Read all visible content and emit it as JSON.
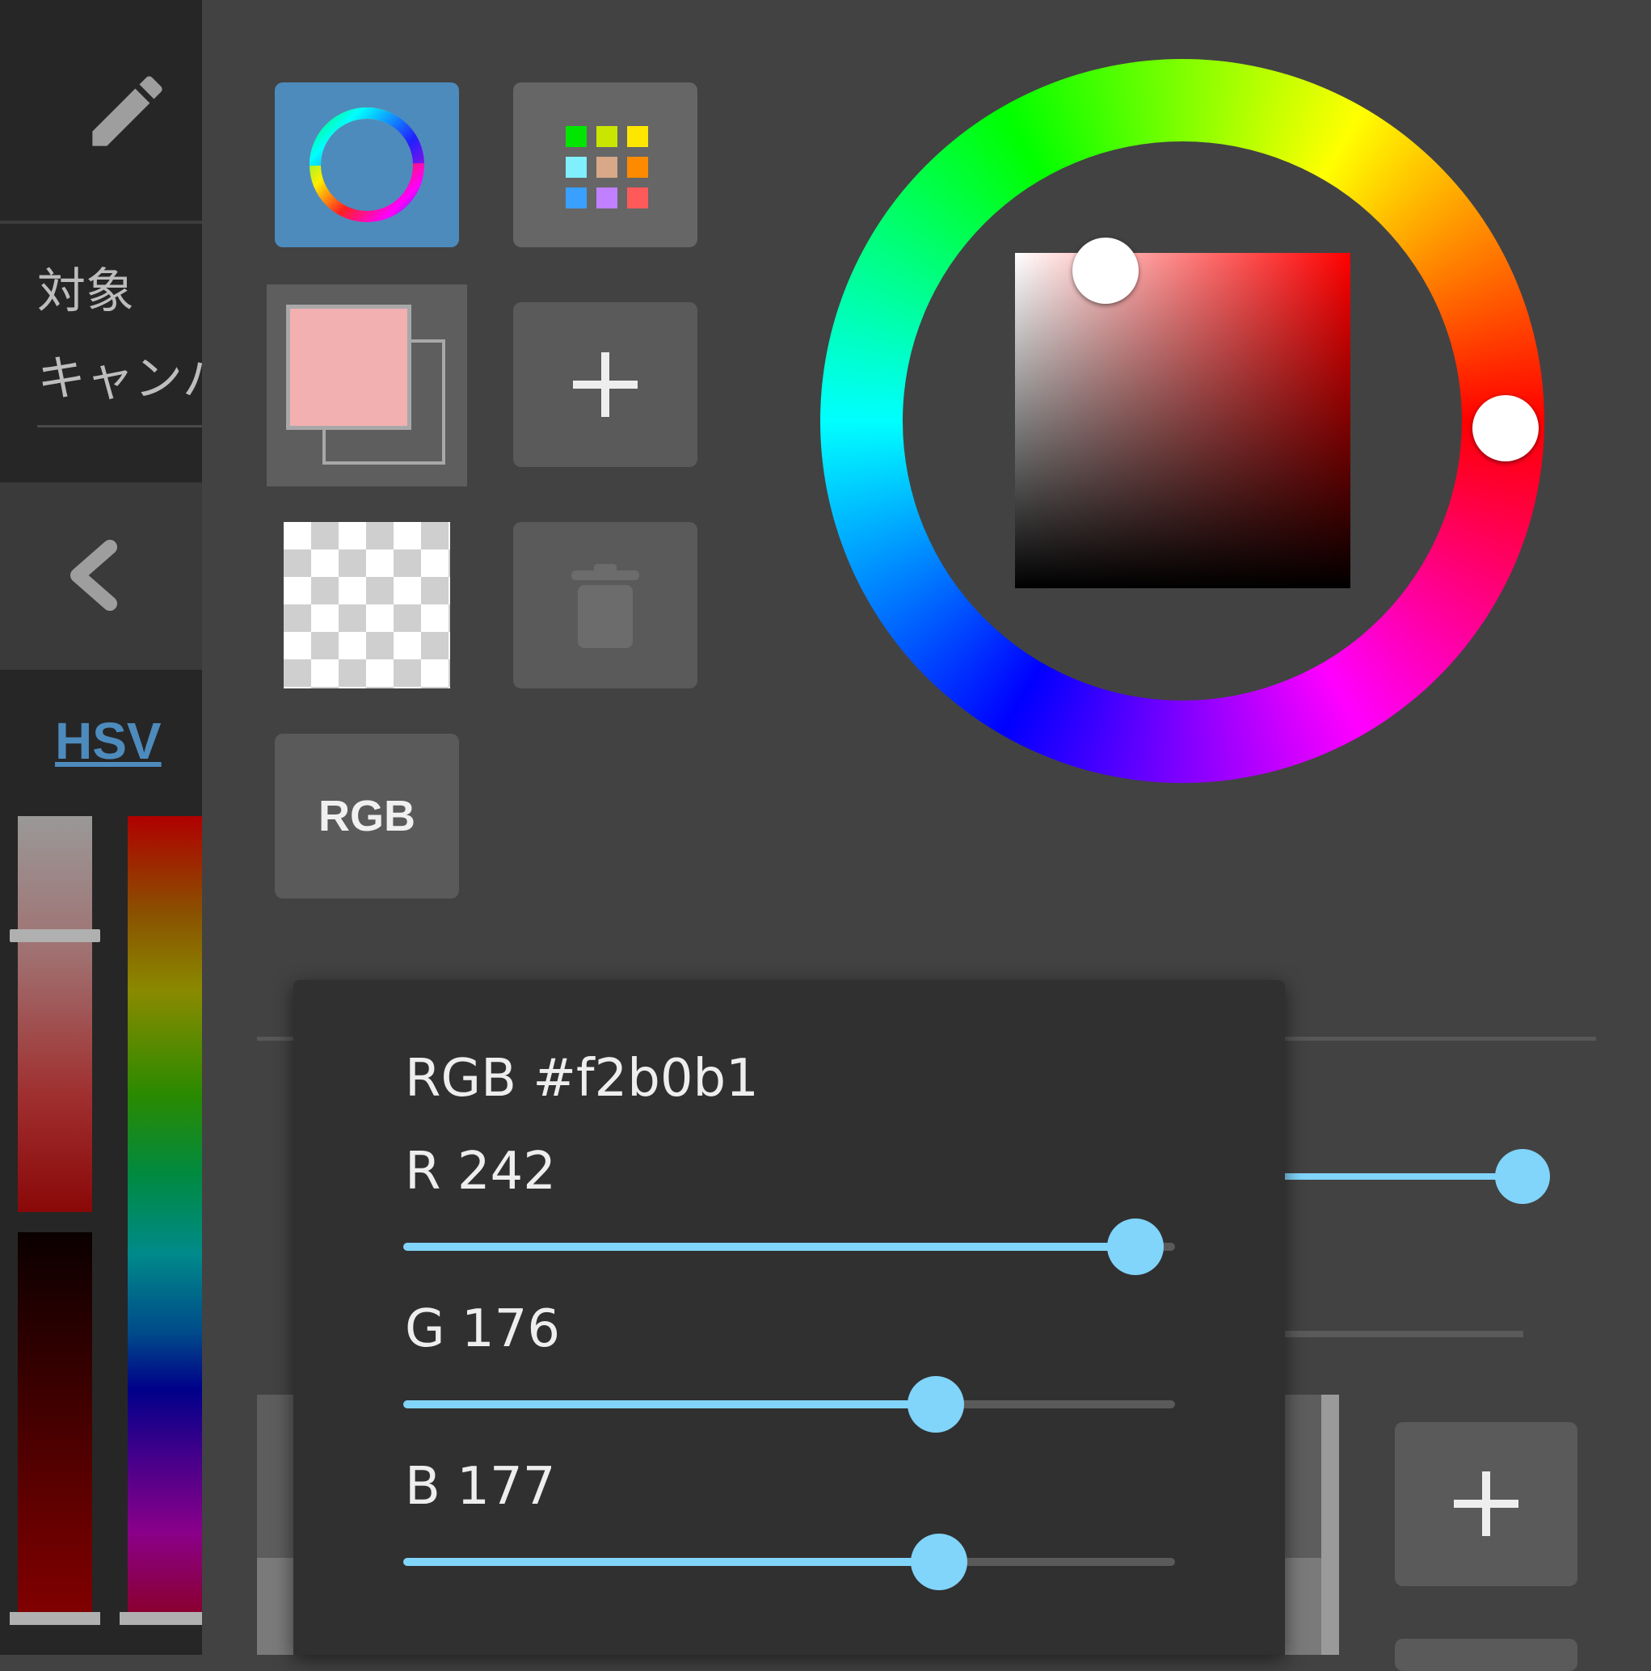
{
  "sidebar": {
    "target_label": "対象",
    "canvas_label": "キャンバ",
    "mode_label": "HSV"
  },
  "toolbar": {
    "rgb_mode_label": "RGB"
  },
  "current_color": "#f2b0b1",
  "rgb_dialog": {
    "title": "RGB #f2b0b1",
    "r_label": "R 242",
    "g_label": "G 176",
    "b_label": "B 177",
    "r": 242,
    "g": 176,
    "b": 177,
    "max": 255
  },
  "palette_colors": [
    "#00e600",
    "#c8e600",
    "#ffe600",
    "#80f0ff",
    "#d8a888",
    "#ff8a00",
    "#3aa0ff",
    "#c080ff",
    "#ff5a5a"
  ],
  "accent_color": "#81d4fa",
  "icons": {
    "pencil": "pencil-icon",
    "back": "chevron-left-icon",
    "wheel": "color-wheel-icon",
    "palette": "palette-grid-icon",
    "add": "plus-icon",
    "delete": "trash-icon"
  }
}
